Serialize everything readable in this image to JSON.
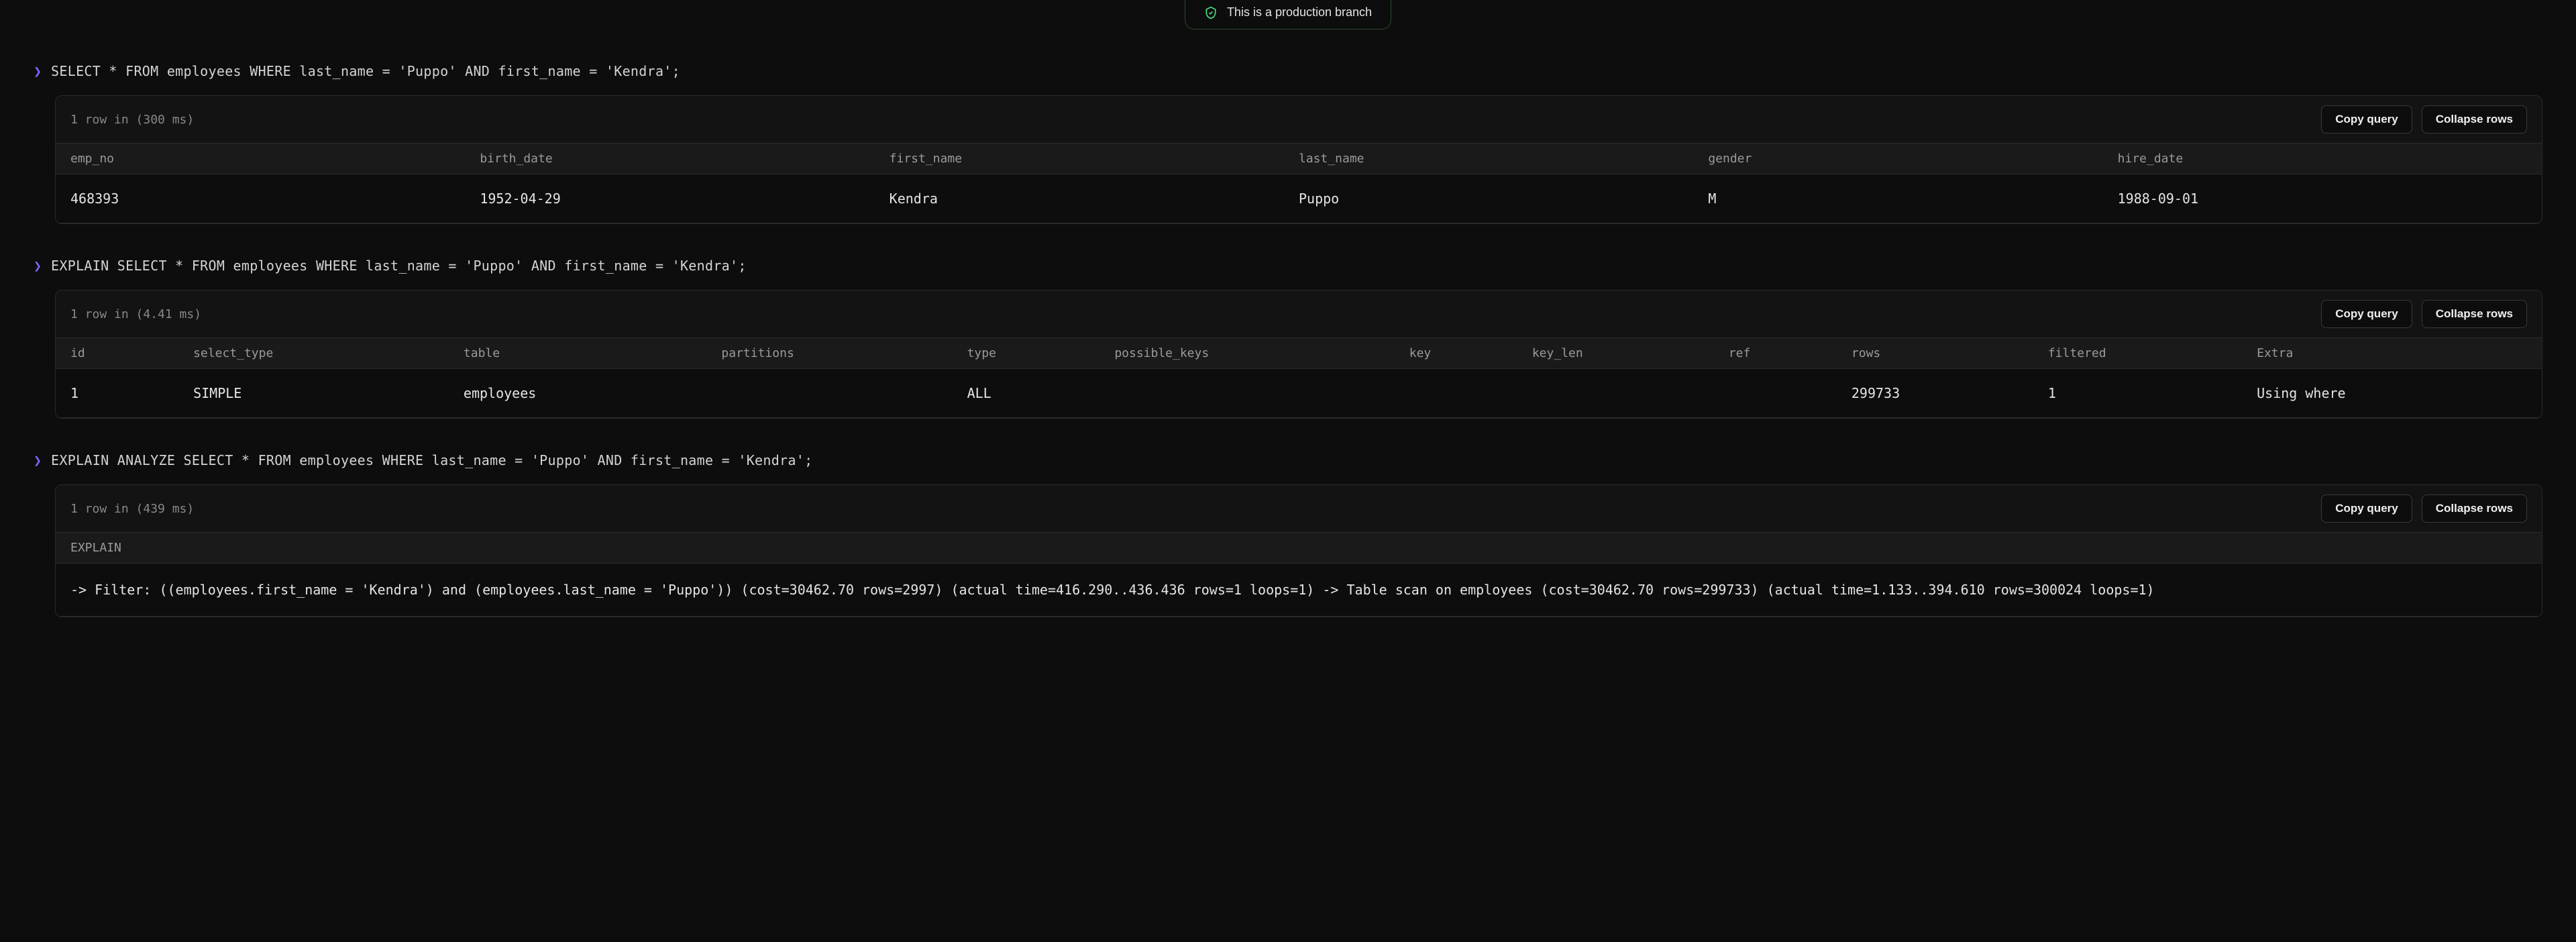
{
  "badge": {
    "label": "This is a production branch",
    "icon": "shield-check"
  },
  "buttons": {
    "copy_query": "Copy query",
    "collapse_rows": "Collapse rows"
  },
  "queries": [
    {
      "prompt": "❯",
      "sql": "SELECT * FROM employees WHERE last_name = 'Puppo' AND first_name = 'Kendra';",
      "meta": "1 row in (300 ms)",
      "columns": [
        "emp_no",
        "birth_date",
        "first_name",
        "last_name",
        "gender",
        "hire_date"
      ],
      "rows": [
        [
          "468393",
          "1952-04-29",
          "Kendra",
          "Puppo",
          "M",
          "1988-09-01"
        ]
      ]
    },
    {
      "prompt": "❯",
      "sql": "EXPLAIN SELECT * FROM employees WHERE last_name = 'Puppo' AND first_name = 'Kendra';",
      "meta": "1 row in (4.41 ms)",
      "columns": [
        "id",
        "select_type",
        "table",
        "partitions",
        "type",
        "possible_keys",
        "key",
        "key_len",
        "ref",
        "rows",
        "filtered",
        "Extra"
      ],
      "rows": [
        [
          "1",
          "SIMPLE",
          "employees",
          "",
          "ALL",
          "",
          "",
          "",
          "",
          "299733",
          "1",
          "Using where"
        ]
      ]
    },
    {
      "prompt": "❯",
      "sql": "EXPLAIN ANALYZE SELECT * FROM employees WHERE last_name = 'Puppo' AND first_name = 'Kendra';",
      "meta": "1 row in (439 ms)",
      "columns": [
        "EXPLAIN"
      ],
      "rows": [
        [
          "-> Filter: ((employees.first_name = 'Kendra') and (employees.last_name = 'Puppo')) (cost=30462.70 rows=2997) (actual time=416.290..436.436 rows=1 loops=1) -> Table scan on employees (cost=30462.70 rows=299733) (actual time=1.133..394.610 rows=300024 loops=1)"
        ]
      ]
    }
  ]
}
